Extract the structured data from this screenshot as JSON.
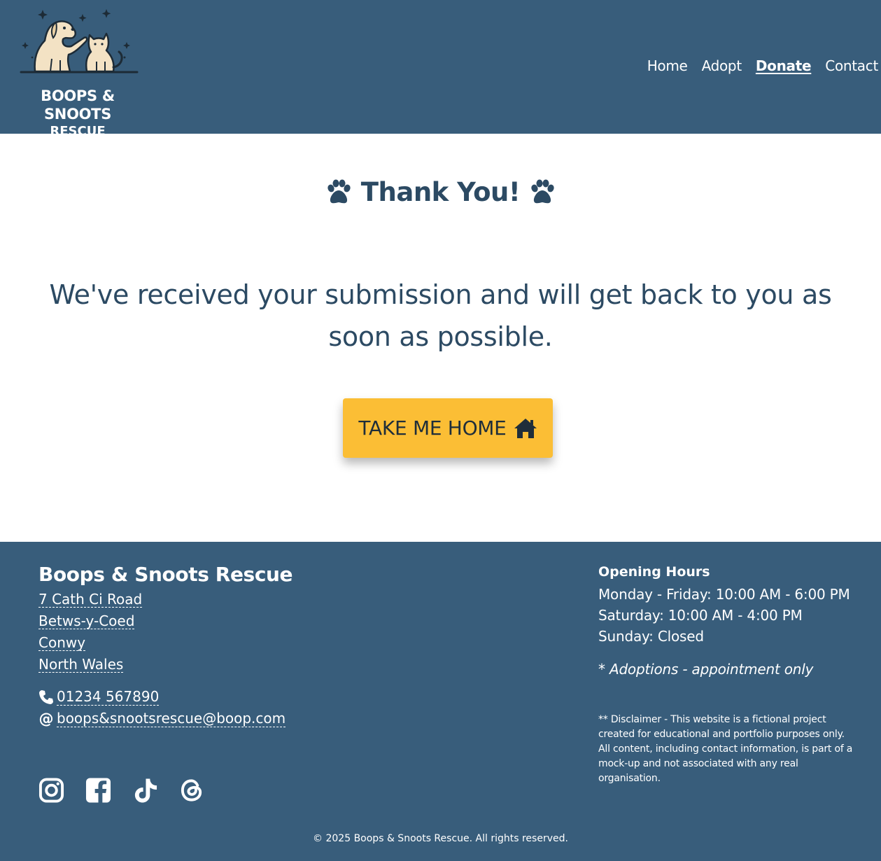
{
  "header": {
    "logo_line1": "BOOPS & SNOOTS",
    "logo_line2": "RESCUE",
    "nav": [
      {
        "label": "Home",
        "active": false
      },
      {
        "label": "Adopt",
        "active": false
      },
      {
        "label": "Donate",
        "active": true
      },
      {
        "label": "Contact",
        "active": false
      }
    ]
  },
  "main": {
    "title": "Thank You!",
    "message": "We've received your submission and will get back to you as soon as possible.",
    "button_label": "TAKE ME HOME",
    "button_icon": "house-icon",
    "title_icons": "paw-icon"
  },
  "footer": {
    "name": "Boops & Snoots Rescue",
    "address": [
      "7 Cath Ci Road",
      "Betws-y-Coed",
      "Conwy",
      "North Wales"
    ],
    "phone": "01234 567890",
    "email": "boops&snootsrescue@boop.com",
    "socials": [
      "instagram-icon",
      "facebook-icon",
      "tiktok-icon",
      "threads-icon"
    ],
    "hours_title": "Opening Hours",
    "hours": [
      "Monday - Friday: 10:00 AM - 6:00 PM",
      "Saturday: 10:00 AM - 4:00 PM",
      "Sunday: Closed"
    ],
    "hours_note": "* Adoptions - appointment only",
    "disclaimer": "** Disclaimer - This website is a fictional project created for educational and portfolio purposes only. All content, including contact information, is part of a mock-up and not associated with any real organisation.",
    "copyright": "© 2025 Boops & Snoots Rescue. All rights reserved."
  },
  "colors": {
    "header_bg": "#385d7b",
    "text_dark": "#2c4a63",
    "button_bg": "#fbbe35",
    "logo_cream": "#f3e2c4"
  }
}
